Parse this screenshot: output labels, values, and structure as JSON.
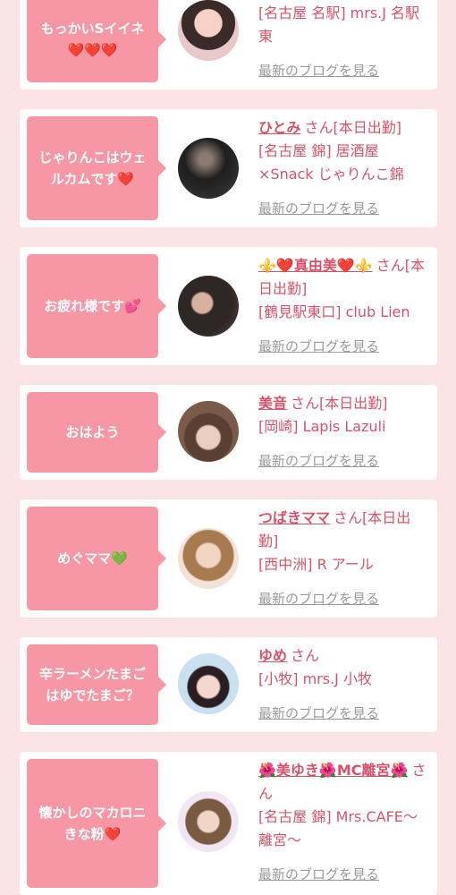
{
  "blog_link_label": "最新のブログを見る",
  "san_label": "さん",
  "cards": [
    {
      "message": "もっかいSイイネ❤️❤️❤️",
      "name": "",
      "status": "",
      "shop": "[名古屋 名駅] mrs.J 名駅東"
    },
    {
      "message": "じゃりんこはウェルカムです❤️",
      "name": "ひとみ",
      "status": "[本日出勤]",
      "shop": "[名古屋 錦] 居酒屋×Snack じゃりんこ錦"
    },
    {
      "message": "お疲れ様です💕",
      "name": "⚜️❤️真由美❤️⚜️",
      "status": "[本日出勤]",
      "shop": "[鶴見駅東口] club Lien"
    },
    {
      "message": "おはよう",
      "name": "美音",
      "status": "[本日出勤]",
      "shop": "[岡崎] Lapis Lazuli"
    },
    {
      "message": "めぐママ💚",
      "name": "つばきママ",
      "status": "[本日出勤]",
      "shop": "[西中洲] R アール"
    },
    {
      "message": "辛ラーメンたまごはゆでたまご？",
      "name": "ゆめ",
      "status": "",
      "shop": "[小牧] mrs.J 小牧"
    },
    {
      "message": "懐かしのマカロニきな粉❤️",
      "name": "🌺美ゆき🌺MC離宮🌺",
      "status": "",
      "shop": "[名古屋 錦] Mrs.CAFE〜離宮〜"
    }
  ],
  "colors": {
    "background": "#fce4e6",
    "bubble": "#f797a6",
    "accent_text": "#d8536a",
    "link_gray": "#9a9a9a"
  }
}
